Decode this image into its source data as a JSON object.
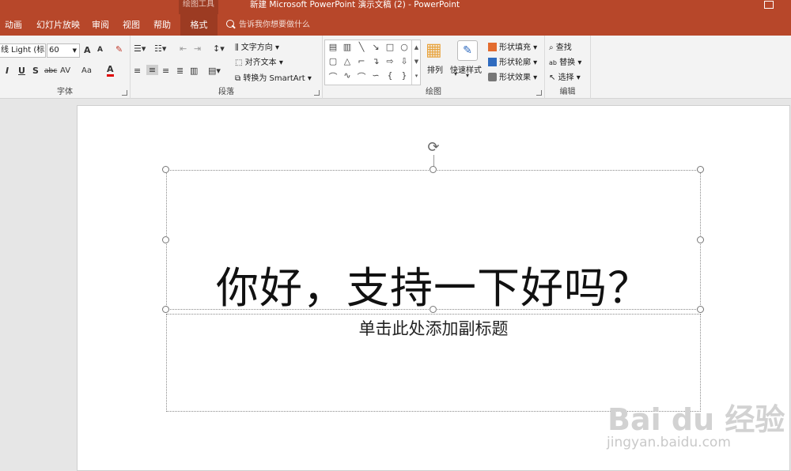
{
  "titlebar": {
    "context_tools": "绘图工具",
    "doc_title": "新建 Microsoft PowerPoint 演示文稿 (2)  -  PowerPoint"
  },
  "tabs": [
    {
      "label": "动画"
    },
    {
      "label": "幻灯片放映"
    },
    {
      "label": "审阅"
    },
    {
      "label": "视图"
    },
    {
      "label": "帮助"
    },
    {
      "label": "格式"
    }
  ],
  "tell_me": "告诉我你想要做什么",
  "ribbon": {
    "font": {
      "group_label": "字体",
      "font_name": "线 Light (标",
      "font_size": "60",
      "grow": "A",
      "shrink": "A",
      "bold": "I",
      "underline": "U",
      "shadow": "S",
      "strike": "abc",
      "spacing": "AV",
      "case": "Aa",
      "color": "A"
    },
    "paragraph": {
      "group_label": "段落",
      "text_direction": "文字方向",
      "align_text": "对齐文本",
      "convert_smartart": "转换为 SmartArt"
    },
    "drawing": {
      "group_label": "绘图",
      "arrange": "排列",
      "quick_styles": "快速样式",
      "shape_fill": "形状填充",
      "shape_outline": "形状轮廓",
      "shape_effects": "形状效果",
      "fill_color": "#e36c2f",
      "outline_color": "#2f6bbf"
    },
    "editing": {
      "group_label": "编辑",
      "find": "查找",
      "replace": "替换",
      "select": "选择"
    }
  },
  "slide": {
    "title": "你好，支持一下好吗？",
    "subtitle_placeholder": "单击此处添加副标题"
  },
  "watermark": {
    "brand": "Bai du 经验",
    "url": "jingyan.baidu.com"
  },
  "colors": {
    "accent": "#b7472a",
    "accent_dark": "#9c3b22",
    "ribbon_bg": "#f3f3f3"
  }
}
